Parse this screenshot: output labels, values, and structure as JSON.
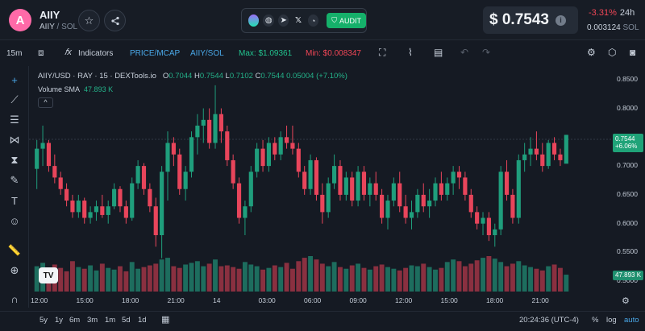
{
  "header": {
    "logo_letter": "A",
    "token_name": "AIIY",
    "pair_base": "AIIY",
    "pair_quote": "SOL",
    "audit_label": "AUDIT",
    "price": "$ 0.7543",
    "change": "-3.31%",
    "change_period": "24h",
    "price_sol": "0.003124",
    "price_sol_unit": "SOL"
  },
  "toolbar": {
    "interval": "15m",
    "indicators": "Indicators",
    "price_mcap": "PRICE/MCAP",
    "pair_toggle": "AIIY/SOL",
    "max_label": "Max: $1.09361",
    "min_label": "Min: $0.008347"
  },
  "legend": {
    "symbol": "AIIY/USD · RAY · 15 · DEXTools.io",
    "o_label": "O",
    "o_value": "0.7044",
    "h_label": "H",
    "h_value": "0.7544",
    "l_label": "L",
    "l_value": "0.7102",
    "c_label": "C",
    "c_value": "0.7544",
    "change_value": "0.05004 (+7.10%)",
    "volume_label": "Volume SMA",
    "volume_value": "47.893 K",
    "collapse_glyph": "^"
  },
  "price_tag": {
    "price": "0.7544",
    "change": "+6.06%"
  },
  "volume_tag": "47.893 K",
  "colors": {
    "up": "#1f9e7c",
    "down": "#e8455b",
    "up_vol": "#1d6d5e",
    "down_vol": "#8a3040"
  },
  "chart_data": {
    "type": "candlestick",
    "y_ticks": [
      "0.8500",
      "0.8000",
      "0.7500",
      "0.7000",
      "0.6500",
      "0.6000",
      "0.5500",
      "0.5000"
    ],
    "y_values": [
      0.85,
      0.8,
      0.75,
      0.7,
      0.65,
      0.6,
      0.55,
      0.5
    ],
    "x_ticks": [
      "12:00",
      "15:00",
      "18:00",
      "21:00",
      "14",
      "03:00",
      "06:00",
      "09:00",
      "12:00",
      "15:00",
      "18:00",
      "21:00"
    ],
    "ylim": [
      0.485,
      0.865
    ],
    "volume_ref": 47893,
    "candles": [
      [
        0.695,
        0.745,
        0.66,
        0.73
      ],
      [
        0.73,
        0.77,
        0.7,
        0.74
      ],
      [
        0.74,
        0.745,
        0.69,
        0.7
      ],
      [
        0.7,
        0.72,
        0.67,
        0.68
      ],
      [
        0.68,
        0.69,
        0.65,
        0.66
      ],
      [
        0.66,
        0.67,
        0.63,
        0.64
      ],
      [
        0.64,
        0.65,
        0.61,
        0.62
      ],
      [
        0.62,
        0.65,
        0.61,
        0.64
      ],
      [
        0.64,
        0.645,
        0.6,
        0.61
      ],
      [
        0.61,
        0.63,
        0.6,
        0.62
      ],
      [
        0.62,
        0.64,
        0.605,
        0.63
      ],
      [
        0.63,
        0.65,
        0.61,
        0.615
      ],
      [
        0.615,
        0.64,
        0.6,
        0.63
      ],
      [
        0.63,
        0.67,
        0.625,
        0.66
      ],
      [
        0.66,
        0.665,
        0.62,
        0.63
      ],
      [
        0.63,
        0.64,
        0.6,
        0.61
      ],
      [
        0.61,
        0.68,
        0.605,
        0.67
      ],
      [
        0.67,
        0.71,
        0.66,
        0.7
      ],
      [
        0.7,
        0.705,
        0.65,
        0.66
      ],
      [
        0.66,
        0.67,
        0.62,
        0.63
      ],
      [
        0.63,
        0.645,
        0.56,
        0.58
      ],
      [
        0.58,
        0.7,
        0.54,
        0.69
      ],
      [
        0.69,
        0.76,
        0.64,
        0.74
      ],
      [
        0.74,
        0.75,
        0.7,
        0.72
      ],
      [
        0.72,
        0.73,
        0.65,
        0.66
      ],
      [
        0.66,
        0.7,
        0.64,
        0.69
      ],
      [
        0.69,
        0.76,
        0.68,
        0.75
      ],
      [
        0.75,
        0.79,
        0.72,
        0.77
      ],
      [
        0.77,
        0.8,
        0.74,
        0.78
      ],
      [
        0.78,
        0.8,
        0.73,
        0.74
      ],
      [
        0.74,
        0.84,
        0.73,
        0.79
      ],
      [
        0.79,
        0.8,
        0.74,
        0.76
      ],
      [
        0.76,
        0.77,
        0.7,
        0.71
      ],
      [
        0.71,
        0.72,
        0.66,
        0.67
      ],
      [
        0.67,
        0.68,
        0.6,
        0.61
      ],
      [
        0.61,
        0.64,
        0.58,
        0.63
      ],
      [
        0.63,
        0.7,
        0.62,
        0.69
      ],
      [
        0.69,
        0.74,
        0.68,
        0.73
      ],
      [
        0.73,
        0.745,
        0.69,
        0.7
      ],
      [
        0.7,
        0.75,
        0.69,
        0.74
      ],
      [
        0.74,
        0.75,
        0.71,
        0.72
      ],
      [
        0.72,
        0.76,
        0.71,
        0.75
      ],
      [
        0.75,
        0.77,
        0.73,
        0.74
      ],
      [
        0.74,
        0.77,
        0.72,
        0.73
      ],
      [
        0.73,
        0.74,
        0.68,
        0.69
      ],
      [
        0.69,
        0.7,
        0.65,
        0.66
      ],
      [
        0.66,
        0.72,
        0.65,
        0.71
      ],
      [
        0.71,
        0.715,
        0.64,
        0.65
      ],
      [
        0.65,
        0.67,
        0.6,
        0.62
      ],
      [
        0.62,
        0.68,
        0.61,
        0.67
      ],
      [
        0.67,
        0.72,
        0.66,
        0.7
      ],
      [
        0.7,
        0.71,
        0.64,
        0.65
      ],
      [
        0.65,
        0.69,
        0.64,
        0.68
      ],
      [
        0.68,
        0.69,
        0.63,
        0.64
      ],
      [
        0.64,
        0.7,
        0.63,
        0.69
      ],
      [
        0.69,
        0.7,
        0.64,
        0.65
      ],
      [
        0.65,
        0.68,
        0.63,
        0.67
      ],
      [
        0.67,
        0.69,
        0.64,
        0.65
      ],
      [
        0.65,
        0.66,
        0.6,
        0.61
      ],
      [
        0.61,
        0.65,
        0.59,
        0.64
      ],
      [
        0.64,
        0.68,
        0.63,
        0.67
      ],
      [
        0.67,
        0.69,
        0.62,
        0.63
      ],
      [
        0.63,
        0.65,
        0.6,
        0.61
      ],
      [
        0.61,
        0.64,
        0.59,
        0.62
      ],
      [
        0.62,
        0.66,
        0.61,
        0.65
      ],
      [
        0.65,
        0.67,
        0.62,
        0.63
      ],
      [
        0.63,
        0.66,
        0.61,
        0.64
      ],
      [
        0.64,
        0.68,
        0.63,
        0.67
      ],
      [
        0.67,
        0.69,
        0.64,
        0.65
      ],
      [
        0.65,
        0.68,
        0.64,
        0.67
      ],
      [
        0.67,
        0.7,
        0.65,
        0.69
      ],
      [
        0.69,
        0.7,
        0.66,
        0.68
      ],
      [
        0.68,
        0.69,
        0.64,
        0.65
      ],
      [
        0.65,
        0.66,
        0.61,
        0.62
      ],
      [
        0.62,
        0.63,
        0.59,
        0.6
      ],
      [
        0.6,
        0.62,
        0.58,
        0.61
      ],
      [
        0.61,
        0.62,
        0.57,
        0.58
      ],
      [
        0.58,
        0.6,
        0.56,
        0.59
      ],
      [
        0.59,
        0.7,
        0.58,
        0.69
      ],
      [
        0.69,
        0.71,
        0.64,
        0.65
      ],
      [
        0.65,
        0.66,
        0.6,
        0.61
      ],
      [
        0.61,
        0.72,
        0.6,
        0.71
      ],
      [
        0.71,
        0.74,
        0.69,
        0.72
      ],
      [
        0.72,
        0.75,
        0.7,
        0.73
      ],
      [
        0.73,
        0.76,
        0.71,
        0.72
      ],
      [
        0.72,
        0.74,
        0.69,
        0.7
      ],
      [
        0.7,
        0.745,
        0.695,
        0.74
      ],
      [
        0.74,
        0.75,
        0.71,
        0.72
      ],
      [
        0.72,
        0.73,
        0.7,
        0.71
      ],
      [
        0.704,
        0.754,
        0.71,
        0.754
      ]
    ],
    "volumes": [
      30,
      34,
      26,
      32,
      28,
      24,
      36,
      29,
      27,
      31,
      25,
      33,
      28,
      26,
      30,
      24,
      35,
      27,
      29,
      31,
      33,
      38,
      40,
      30,
      28,
      32,
      34,
      36,
      30,
      33,
      38,
      30,
      31,
      29,
      27,
      35,
      32,
      30,
      26,
      28,
      31,
      29,
      34,
      27,
      36,
      40,
      42,
      38,
      33,
      30,
      35,
      29,
      27,
      31,
      33,
      28,
      26,
      30,
      32,
      29,
      27,
      25,
      28,
      31,
      30,
      33,
      29,
      26,
      28,
      35,
      38,
      36,
      30,
      33,
      37,
      40,
      42,
      39,
      35,
      30,
      33,
      36,
      31,
      29,
      27,
      25,
      30,
      32,
      28,
      20
    ]
  },
  "bottom": {
    "ranges": [
      "5y",
      "1y",
      "6m",
      "3m",
      "1m",
      "5d",
      "1d"
    ],
    "clock": "20:24:36 (UTC-4)",
    "percent": "%",
    "log": "log",
    "auto": "auto"
  }
}
